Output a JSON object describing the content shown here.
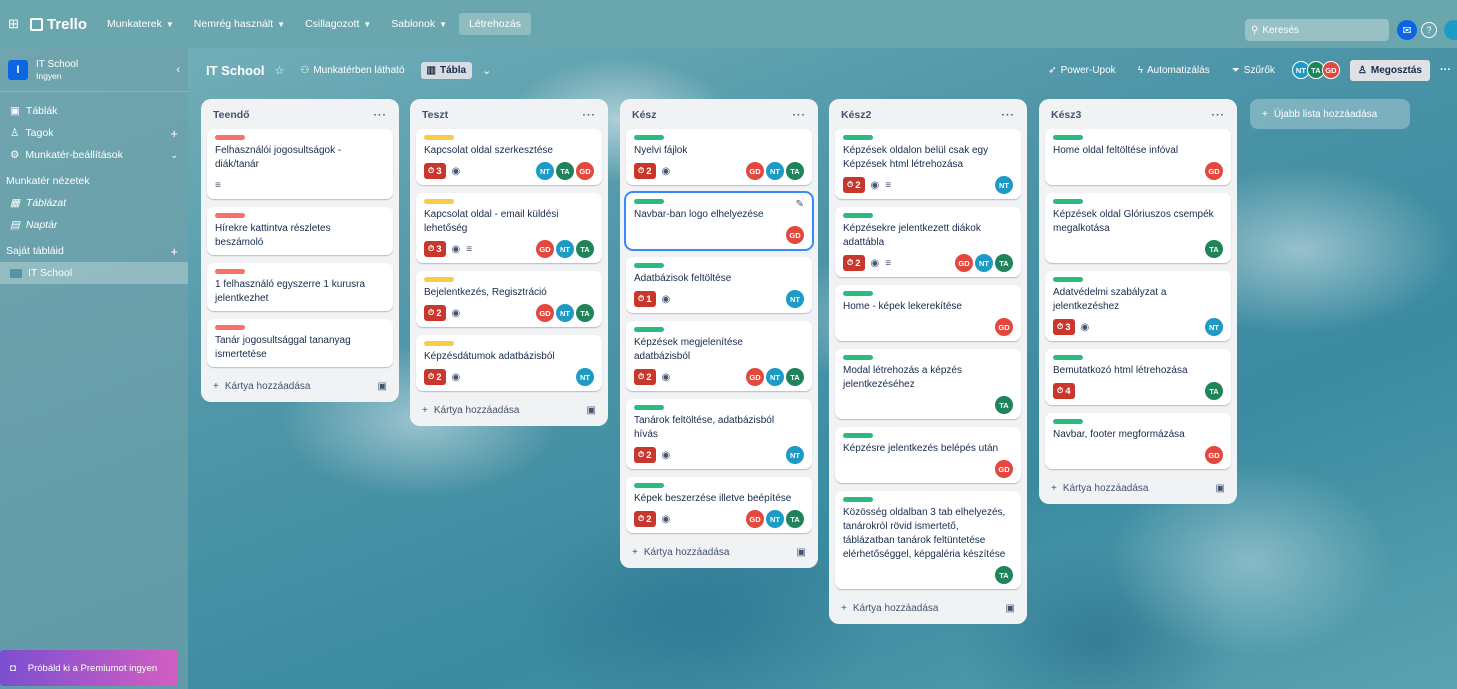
{
  "topbar": {
    "logo": "Trello",
    "nav": [
      "Munkaterek",
      "Nemrég használt",
      "Csillagozott",
      "Sablonok"
    ],
    "create": "Létrehozás",
    "search_placeholder": "Keresés"
  },
  "sidebar": {
    "workspace_name": "IT School",
    "workspace_plan": "Ingyen",
    "workspace_initial": "I",
    "items": [
      {
        "label": "Táblák"
      },
      {
        "label": "Tagok"
      },
      {
        "label": "Munkatér-beállítások"
      }
    ],
    "views_title": "Munkatér nézetek",
    "views": [
      {
        "label": "Táblázat"
      },
      {
        "label": "Naptár"
      }
    ],
    "boards_title": "Saját tábláid",
    "boards": [
      {
        "label": "IT School"
      }
    ],
    "premium": "Próbáld ki a Premiumot ingyen"
  },
  "board": {
    "title": "IT School",
    "visibility": "Munkatérben látható",
    "view": "Tábla",
    "power_ups": "Power-Upok",
    "automation": "Automatizálás",
    "filter": "Szűrők",
    "share": "Megosztás",
    "members": [
      "NT",
      "TA",
      "GD"
    ],
    "add_list": "Újabb lista hozzáadása",
    "add_card": "Kártya hozzáadása"
  },
  "colors": {
    "red_label": "#f87168",
    "yellow_label": "#f5cd47",
    "green_label": "#2abb7f",
    "GD": "#e2483d",
    "NT": "#1d9bc5",
    "TA": "#1f845a"
  },
  "lists": [
    {
      "title": "Teendő",
      "cards": [
        {
          "label": "red",
          "title": "Felhasználói jogosultságok - diák/tanár",
          "desc": true
        },
        {
          "label": "red",
          "title": "Hírekre kattintva részletes beszámoló"
        },
        {
          "label": "red",
          "title": "1 felhasználó egyszerre 1 kurusra jelentkezhet"
        },
        {
          "label": "red",
          "title": "Tanár jogosultsággal tananyag ismertetése"
        }
      ]
    },
    {
      "title": "Teszt",
      "cards": [
        {
          "label": "yellow",
          "title": "Kapcsolat oldal szerkesztése",
          "badge": "3",
          "watch": true,
          "members": [
            "NT",
            "TA",
            "GD"
          ]
        },
        {
          "label": "yellow",
          "title": "Kapcsolat oldal - email küldési lehetőség",
          "badge": "3",
          "watch": true,
          "desc": true,
          "members": [
            "GD",
            "NT",
            "TA"
          ]
        },
        {
          "label": "yellow",
          "title": "Bejelentkezés, Regisztráció",
          "badge": "2",
          "watch": true,
          "members": [
            "GD",
            "NT",
            "TA"
          ]
        },
        {
          "label": "yellow",
          "title": "Képzésdátumok adatbázisból",
          "badge": "2",
          "watch": true,
          "members": [
            "NT"
          ]
        }
      ]
    },
    {
      "title": "Kész",
      "cards": [
        {
          "label": "green",
          "title": "Nyelvi fájlok",
          "badge": "2",
          "watch": true,
          "members": [
            "GD",
            "NT",
            "TA"
          ]
        },
        {
          "label": "green",
          "title": "Navbar-ban logo elhelyezése",
          "members": [
            "GD"
          ],
          "selected": true
        },
        {
          "label": "green",
          "title": "Adatbázisok feltöltése",
          "badge": "1",
          "watch": true,
          "members": [
            "NT"
          ]
        },
        {
          "label": "green",
          "title": "Képzések megjelenítése adatbázisból",
          "badge": "2",
          "watch": true,
          "members": [
            "GD",
            "NT",
            "TA"
          ]
        },
        {
          "label": "green",
          "title": "Tanárok feltöltése, adatbázisból hívás",
          "badge": "2",
          "watch": true,
          "members": [
            "NT"
          ]
        },
        {
          "label": "green",
          "title": "Képek beszerzése illetve beépítése",
          "badge": "2",
          "watch": true,
          "members": [
            "GD",
            "NT",
            "TA"
          ]
        }
      ]
    },
    {
      "title": "Kész2",
      "cards": [
        {
          "label": "green",
          "title": "Képzések oldalon belül csak egy Képzések html létrehozása",
          "badge": "2",
          "watch": true,
          "desc": true,
          "members": [
            "NT"
          ]
        },
        {
          "label": "green",
          "title": "Képzésekre jelentkezett diákok adattábla",
          "badge": "2",
          "watch": true,
          "desc": true,
          "members": [
            "GD",
            "NT",
            "TA"
          ]
        },
        {
          "label": "green",
          "title": "Home - képek lekerekítése",
          "members": [
            "GD"
          ]
        },
        {
          "label": "green",
          "title": "Modal létrehozás a képzés jelentkezéséhez",
          "members": [
            "TA"
          ]
        },
        {
          "label": "green",
          "title": "Képzésre jelentkezés belépés után",
          "members": [
            "GD"
          ]
        },
        {
          "label": "green",
          "title": "Közösség oldalban 3 tab elhelyezés, tanárokról rövid ismertető, táblázatban tanárok feltüntetése elérhetőséggel, képgaléria készítése",
          "members": [
            "TA"
          ]
        }
      ]
    },
    {
      "title": "Kész3",
      "cards": [
        {
          "label": "green",
          "title": "Home oldal feltöltése infóval",
          "members": [
            "GD"
          ]
        },
        {
          "label": "green",
          "title": "Képzések oldal Glóriuszos csempék megalkotása",
          "members": [
            "TA"
          ]
        },
        {
          "label": "green",
          "title": "Adatvédelmi szabályzat a jelentkezéshez",
          "badge": "3",
          "watch": true,
          "members": [
            "NT"
          ]
        },
        {
          "label": "green",
          "title": "Bemutatkozó html létrehozása",
          "badge": "4",
          "members": [
            "TA"
          ]
        },
        {
          "label": "green",
          "title": "Navbar, footer megformázása",
          "members": [
            "GD"
          ]
        }
      ]
    }
  ]
}
